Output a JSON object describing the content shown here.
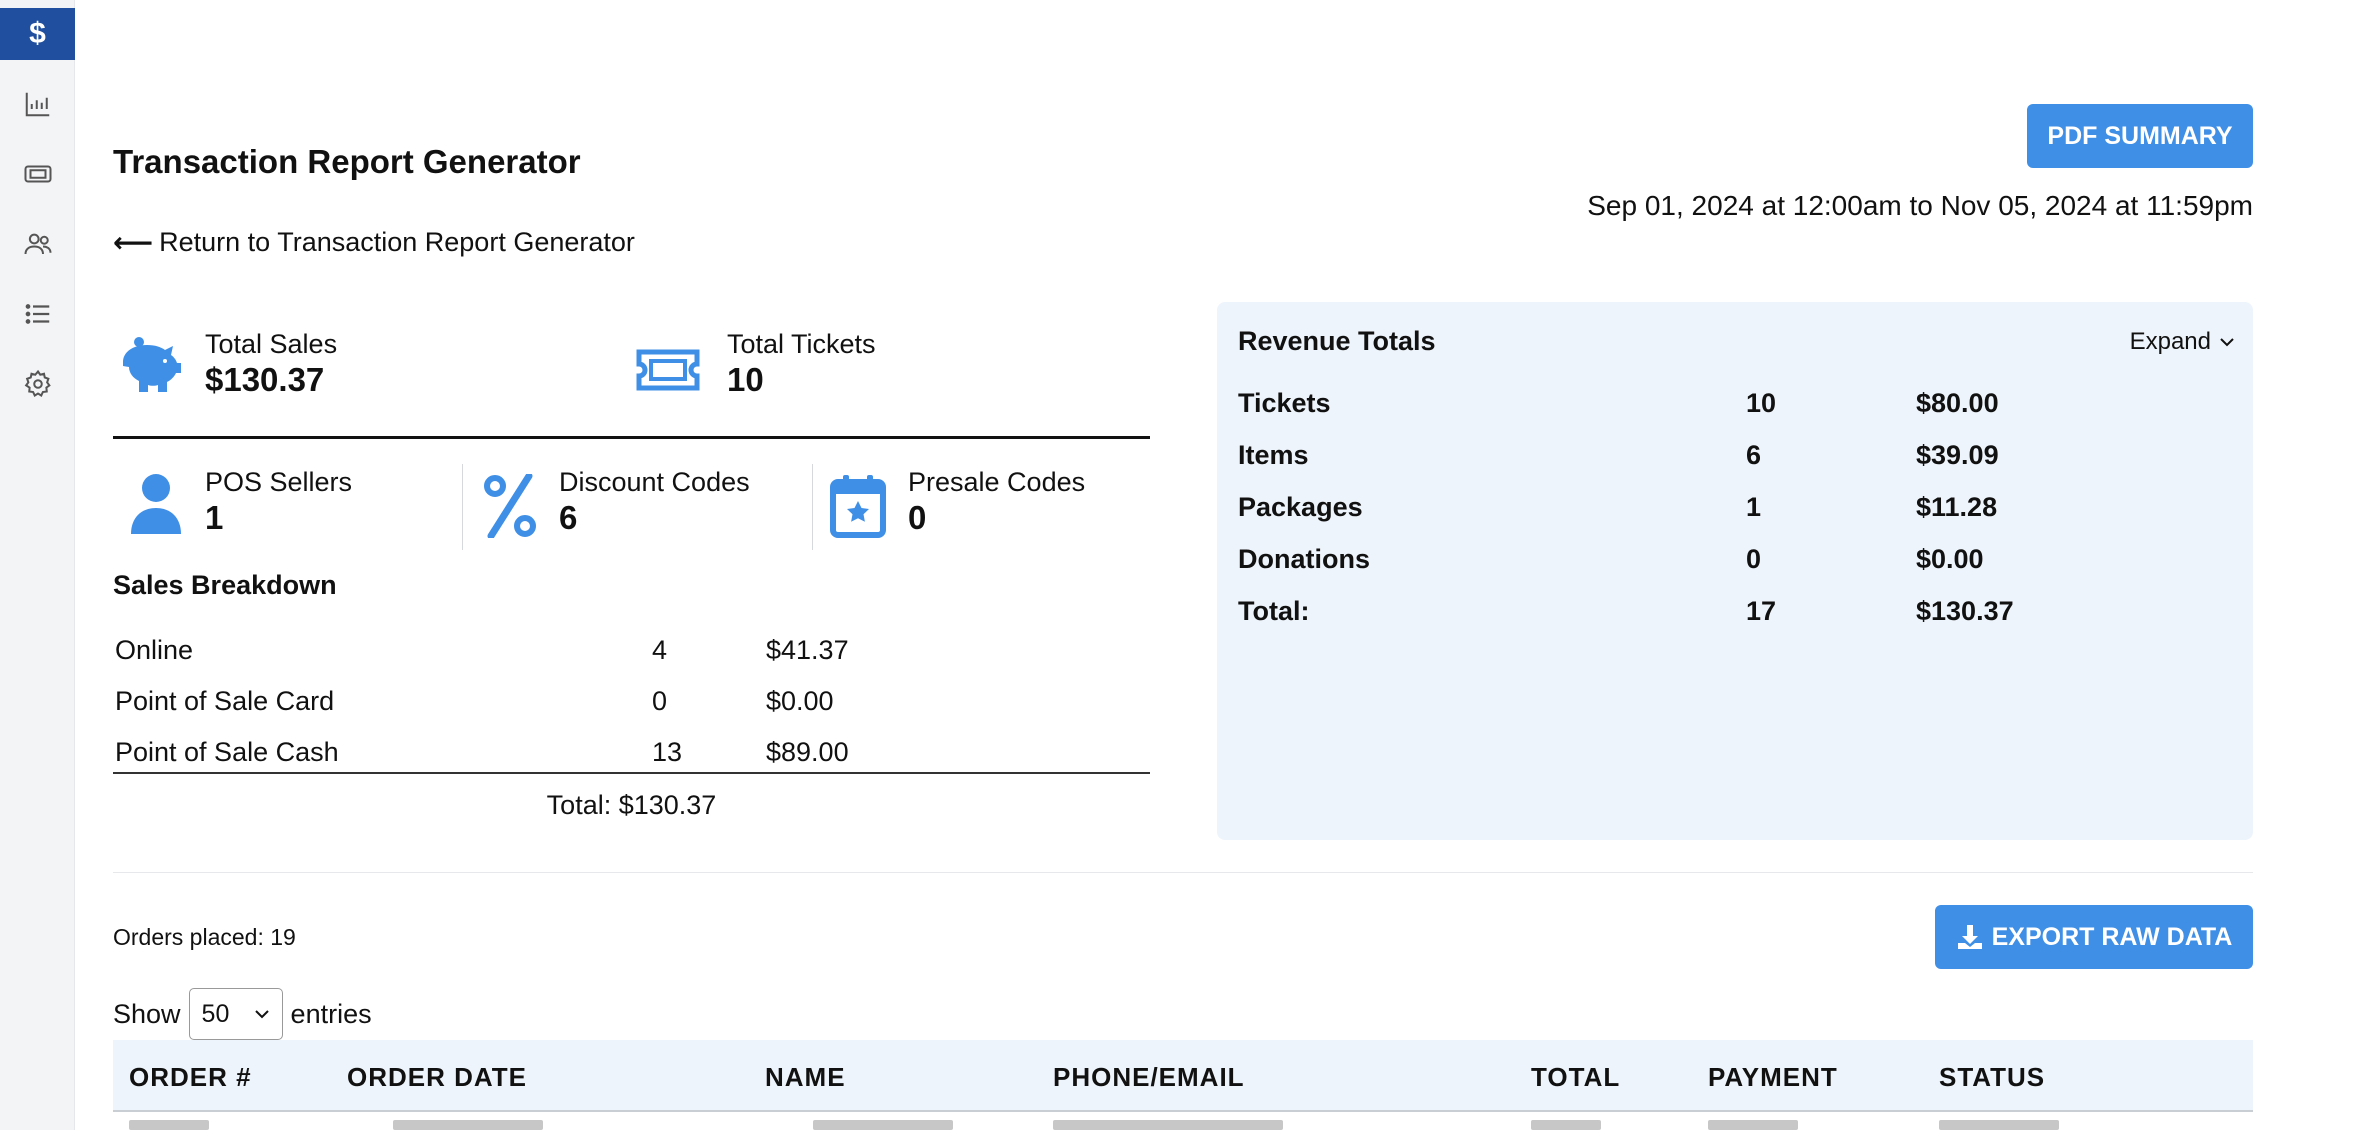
{
  "sidebar": {
    "items": [
      {
        "name": "transactions",
        "icon": "dollar-icon",
        "active": true
      },
      {
        "name": "reports",
        "icon": "bar-chart-icon"
      },
      {
        "name": "tickets",
        "icon": "ticket-icon"
      },
      {
        "name": "users",
        "icon": "users-icon"
      },
      {
        "name": "lists",
        "icon": "list-icon"
      },
      {
        "name": "settings",
        "icon": "gear-icon"
      }
    ]
  },
  "header": {
    "title": "Transaction Report Generator",
    "back_link": "Return to Transaction Report Generator",
    "pdf_button": "PDF SUMMARY",
    "date_range": "Sep 01, 2024 at 12:00am to Nov 05, 2024 at 11:59pm"
  },
  "stats": {
    "total_sales": {
      "label": "Total Sales",
      "value": "$130.37",
      "icon": "piggy-bank-icon"
    },
    "total_tickets": {
      "label": "Total Tickets",
      "value": "10",
      "icon": "ticket-icon"
    },
    "pos_sellers": {
      "label": "POS Sellers",
      "value": "1",
      "icon": "user-icon"
    },
    "discount_codes": {
      "label": "Discount Codes",
      "value": "6",
      "icon": "percent-icon"
    },
    "presale_codes": {
      "label": "Presale Codes",
      "value": "0",
      "icon": "calendar-star-icon"
    }
  },
  "sales_breakdown": {
    "title": "Sales Breakdown",
    "rows": [
      {
        "name": "Online",
        "count": "4",
        "amount": "$41.37"
      },
      {
        "name": "Point of Sale Card",
        "count": "0",
        "amount": "$0.00"
      },
      {
        "name": "Point of Sale Cash",
        "count": "13",
        "amount": "$89.00"
      }
    ],
    "total": "Total: $130.37"
  },
  "revenue": {
    "title": "Revenue Totals",
    "expand_label": "Expand",
    "rows": [
      {
        "name": "Tickets",
        "count": "10",
        "amount": "$80.00"
      },
      {
        "name": "Items",
        "count": "6",
        "amount": "$39.09"
      },
      {
        "name": "Packages",
        "count": "1",
        "amount": "$11.28"
      },
      {
        "name": "Donations",
        "count": "0",
        "amount": "$0.00"
      },
      {
        "name": "Total:",
        "count": "17",
        "amount": "$130.37"
      }
    ]
  },
  "orders": {
    "placed_text": "Orders placed: 19",
    "export_button": "EXPORT RAW DATA",
    "show_label": "Show",
    "entries_value": "50",
    "entries_label": "entries",
    "columns": [
      "ORDER #",
      "ORDER DATE",
      "NAME",
      "PHONE/EMAIL",
      "TOTAL",
      "PAYMENT",
      "STATUS"
    ]
  },
  "colors": {
    "accent": "#3f8fe6",
    "sidebar_active": "#1f4f9e",
    "panel_bg": "#eef4fb"
  }
}
